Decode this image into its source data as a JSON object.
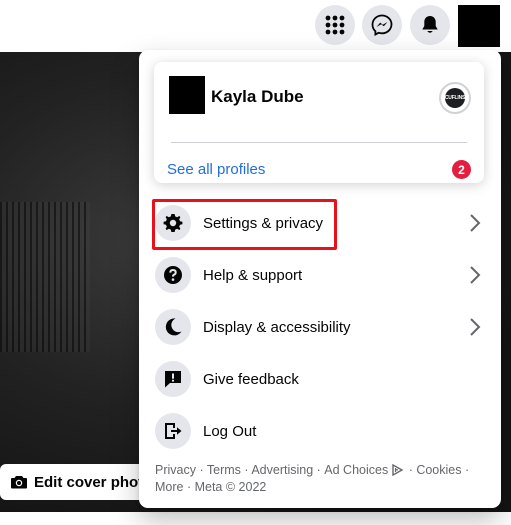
{
  "topbar": {
    "icons": [
      "menu-grid-icon",
      "messenger-icon",
      "bell-icon"
    ]
  },
  "cover": {
    "edit_cover_label": "Edit cover phot"
  },
  "profile": {
    "name": "Kayla Dube",
    "see_all_label": "See all profiles",
    "notification_count": "2",
    "switch_badge_text": "CUFLINS"
  },
  "menu": {
    "items": [
      {
        "label": "Settings & privacy",
        "icon": "gear-icon",
        "has_chevron": true
      },
      {
        "label": "Help & support",
        "icon": "question-icon",
        "has_chevron": true
      },
      {
        "label": "Display & accessibility",
        "icon": "moon-icon",
        "has_chevron": true
      },
      {
        "label": "Give feedback",
        "icon": "feedback-icon",
        "has_chevron": false
      },
      {
        "label": "Log Out",
        "icon": "logout-icon",
        "has_chevron": false
      }
    ]
  },
  "footer": {
    "privacy": "Privacy",
    "terms": "Terms",
    "advertising": "Advertising",
    "ad_choices": "Ad Choices",
    "cookies": "Cookies",
    "more": "More",
    "copyright": "Meta © 2022",
    "separator": " · "
  },
  "colors": {
    "accent_link": "#216fdb",
    "badge_red": "#e41e3f",
    "highlight_red": "#e8111b",
    "icon_bg": "#e4e6eb"
  }
}
